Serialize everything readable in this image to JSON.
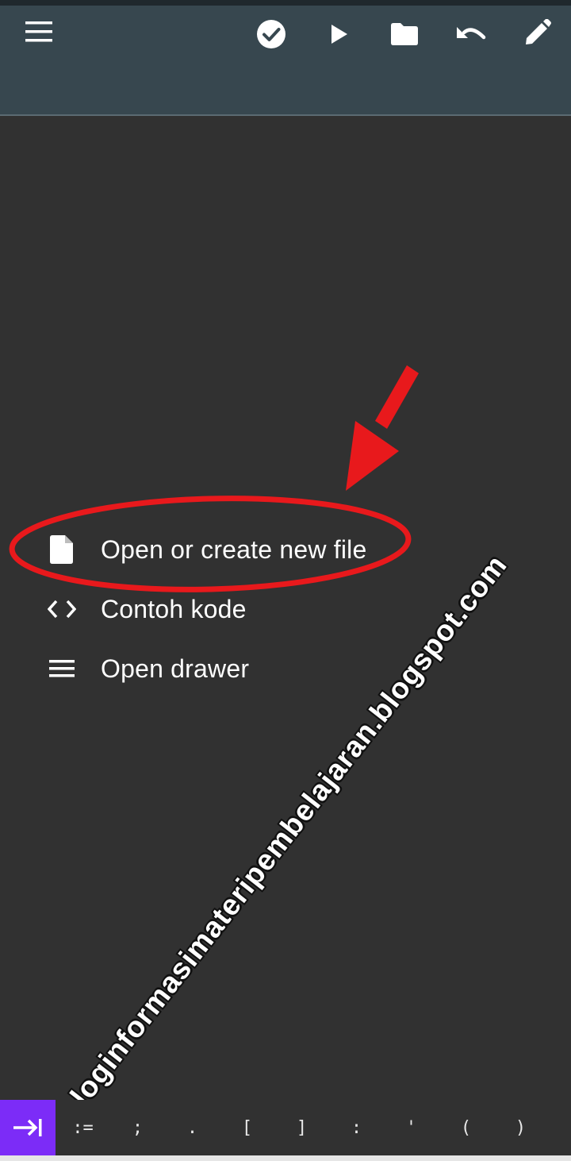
{
  "app_bar": {
    "icons": {
      "menu": "menu-icon",
      "check": "check-circle-icon",
      "run": "play-icon",
      "folder": "folder-icon",
      "undo": "undo-icon",
      "edit": "pencil-icon"
    },
    "background": "#37474f"
  },
  "start_menu": {
    "items": [
      {
        "label": "Open or create new file",
        "icon": "file-icon"
      },
      {
        "label": "Contoh kode",
        "icon": "code-icon"
      },
      {
        "label": "Open drawer",
        "icon": "menu-icon"
      }
    ]
  },
  "annotation": {
    "color": "#e8191c",
    "arrow": "red-arrow",
    "highlight": "red-ellipse"
  },
  "watermark": {
    "text": "bloginformasimateripembelajaran.blogspot.com"
  },
  "key_bar": {
    "tab_icon": "tab-arrow-icon",
    "accent": "#7c2cf7",
    "keys": [
      ":=",
      ";",
      ".",
      "[",
      "]",
      ":",
      "'",
      "(",
      ")"
    ]
  }
}
